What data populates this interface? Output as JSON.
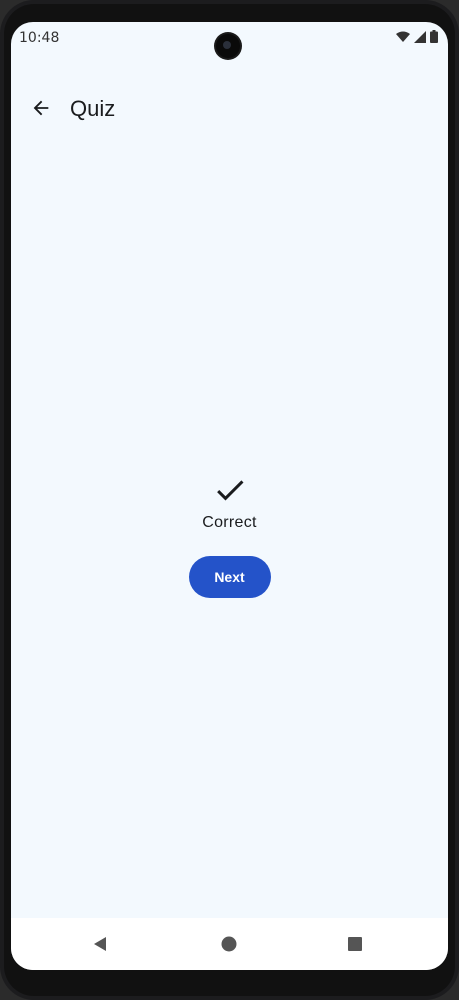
{
  "status_bar": {
    "time": "10:48",
    "icons": [
      "wifi-icon",
      "signal-icon",
      "battery-icon"
    ]
  },
  "app_bar": {
    "title": "Quiz",
    "back_icon": "arrow-back-icon"
  },
  "result": {
    "icon": "check-icon",
    "text": "Correct"
  },
  "actions": {
    "next_label": "Next"
  },
  "nav_bar": {
    "icons": [
      "nav-back-icon",
      "nav-home-icon",
      "nav-recents-icon"
    ]
  },
  "colors": {
    "background": "#f3f9fe",
    "primary": "#2453c9",
    "text": "#1a1c1e"
  }
}
